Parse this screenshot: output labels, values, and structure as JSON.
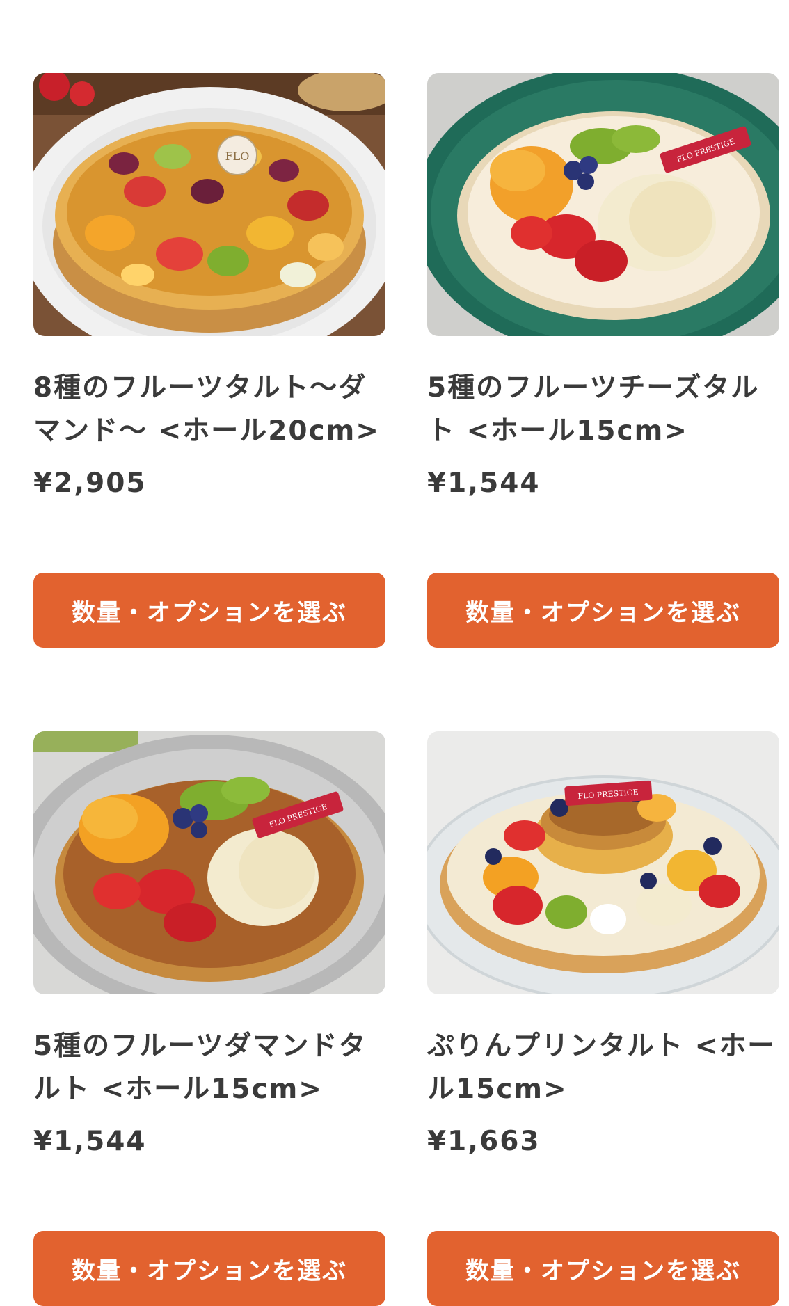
{
  "products": [
    {
      "name": "8種のフルーツタルト〜ダマンド〜 <ホール20cm>",
      "price": "¥2,905",
      "button_label": "数量・オプションを選ぶ",
      "image_label": "FLO"
    },
    {
      "name": "5種のフルーツチーズタルト <ホール15cm>",
      "price": "¥1,544",
      "button_label": "数量・オプションを選ぶ",
      "image_label": "FLO PRESTIGE"
    },
    {
      "name": "5種のフルーツダマンドタルト <ホール15cm>",
      "price": "¥1,544",
      "button_label": "数量・オプションを選ぶ",
      "image_label": "FLO PRESTIGE"
    },
    {
      "name": "ぷりんプリンタルト <ホール15cm>",
      "price": "¥1,663",
      "button_label": "数量・オプションを選ぶ",
      "image_label": "FLO PRESTIGE"
    }
  ],
  "colors": {
    "button": "#e2622f",
    "text": "#3a3a3a"
  }
}
